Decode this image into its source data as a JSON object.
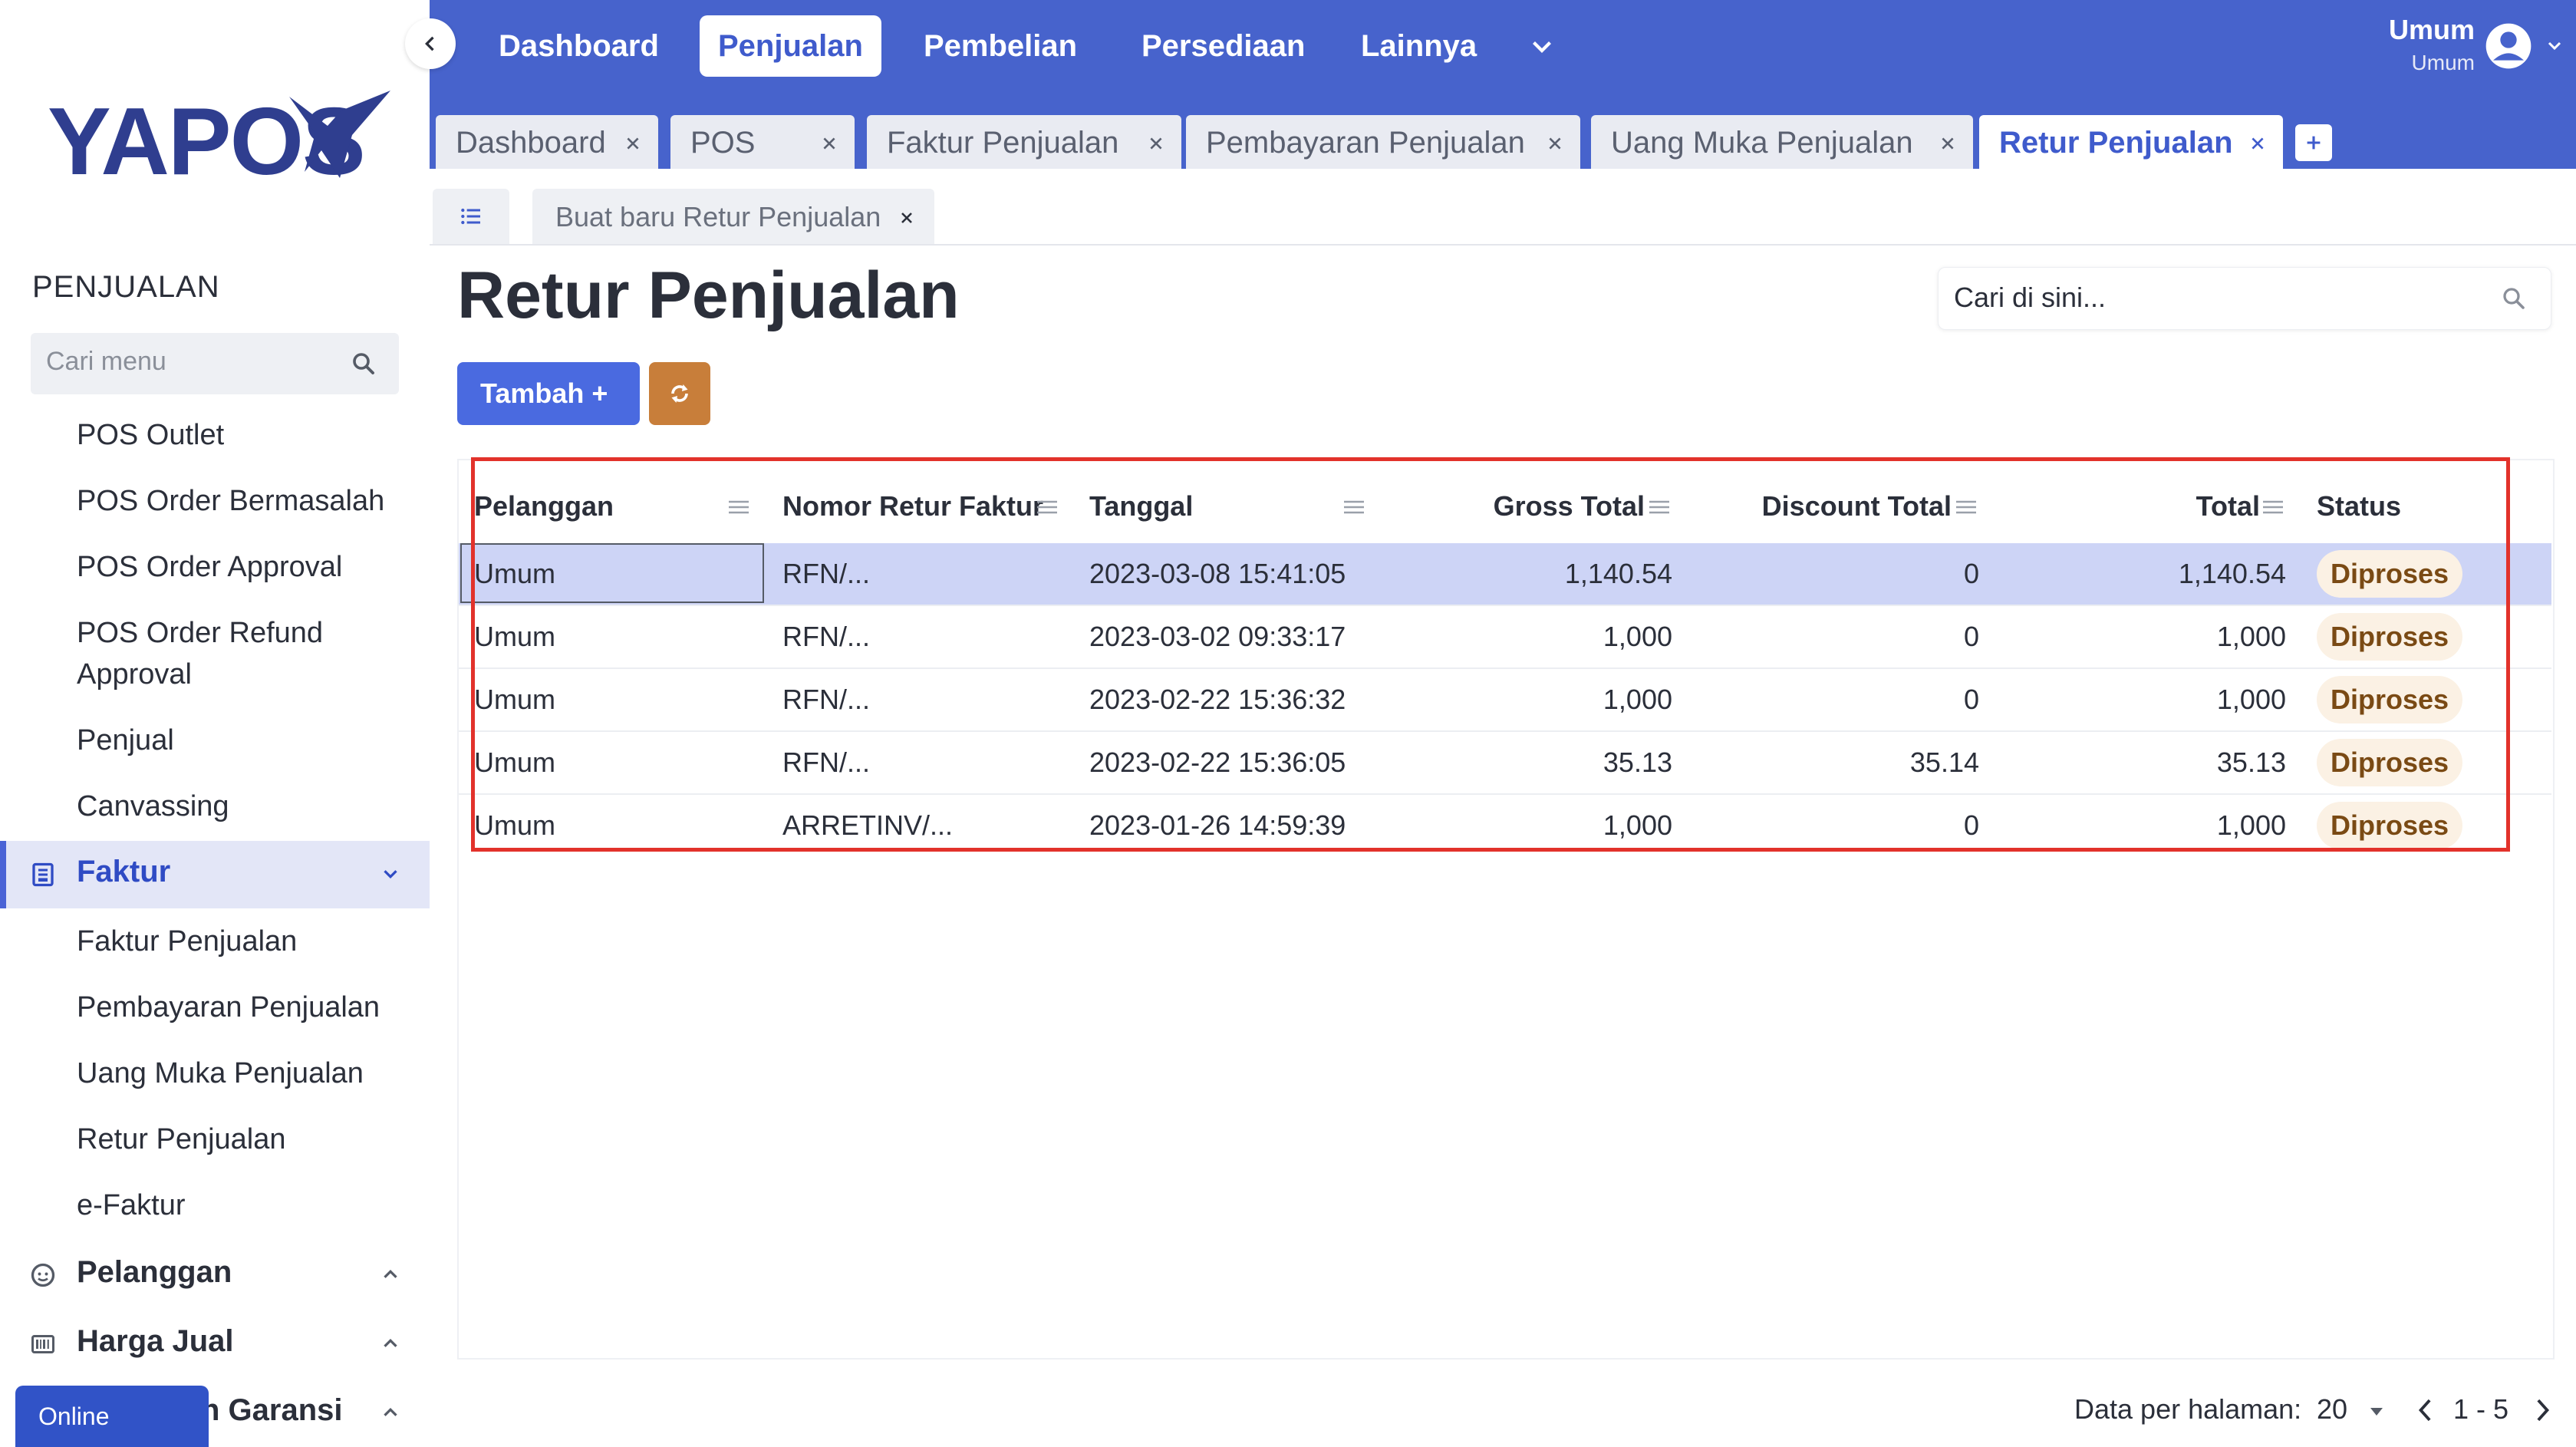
{
  "brand": {
    "logo_text": "YAPOS"
  },
  "sidebar": {
    "heading": "PENJUALAN",
    "search_placeholder": "Cari menu",
    "items_top": [
      "POS Outlet",
      "POS Order Bermasalah",
      "POS Order Approval",
      "POS Order Refund",
      "Approval",
      "Penjual",
      "Canvassing"
    ],
    "group_faktur": "Faktur",
    "items_faktur": [
      "Faktur Penjualan",
      "Pembayaran Penjualan",
      "Uang Muka Penjualan",
      "Retur Penjualan",
      "e-Faktur"
    ],
    "group_pelanggan": "Pelanggan",
    "group_harga": "Harga Jual",
    "group_garansi": "n Garansi",
    "online_label": "Online"
  },
  "topnav": {
    "items": [
      "Dashboard",
      "Penjualan",
      "Pembelian",
      "Persediaan",
      "Lainnya"
    ],
    "active_index": 1,
    "user_name": "Umum",
    "user_role": "Umum"
  },
  "tabs": [
    {
      "label": "Dashboard"
    },
    {
      "label": "POS"
    },
    {
      "label": "Faktur Penjualan"
    },
    {
      "label": "Pembayaran Penjualan"
    },
    {
      "label": "Uang Muka Penjualan"
    },
    {
      "label": "Retur Penjualan",
      "active": true
    }
  ],
  "subtabs": {
    "new_label": "Buat baru Retur Penjualan"
  },
  "page": {
    "title": "Retur Penjualan",
    "search_placeholder": "Cari di sini...",
    "add_button": "Tambah +"
  },
  "table": {
    "columns": [
      "Pelanggan",
      "Nomor Retur Faktur",
      "Tanggal",
      "Gross Total",
      "Discount Total",
      "Total",
      "Status"
    ],
    "rows": [
      [
        "Umum",
        "RFN/...",
        "2023-03-08 15:41:05",
        "1,140.54",
        "0",
        "1,140.54",
        "Diproses"
      ],
      [
        "Umum",
        "RFN/...",
        "2023-03-02 09:33:17",
        "1,000",
        "0",
        "1,000",
        "Diproses"
      ],
      [
        "Umum",
        "RFN/...",
        "2023-02-22 15:36:32",
        "1,000",
        "0",
        "1,000",
        "Diproses"
      ],
      [
        "Umum",
        "RFN/...",
        "2023-02-22 15:36:05",
        "35.13",
        "35.14",
        "35.13",
        "Diproses"
      ],
      [
        "Umum",
        "ARRETINV/...",
        "2023-01-26 14:59:39",
        "1,000",
        "0",
        "1,000",
        "Diproses"
      ]
    ]
  },
  "footer": {
    "per_page_label": "Data per halaman:",
    "per_page_value": "20",
    "range": "1 - 5"
  },
  "colors": {
    "brand_blue": "#4763cc",
    "add_button": "#4a6ae0",
    "refresh_button": "#c87e3a",
    "highlight": "#e2322b",
    "selected_row": "#cdd4f6"
  }
}
